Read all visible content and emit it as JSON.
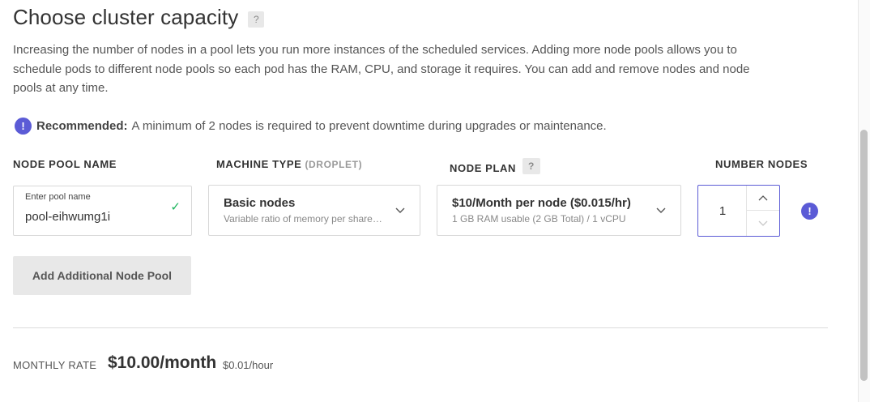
{
  "header": {
    "title": "Choose cluster capacity",
    "help_label": "?"
  },
  "description": "Increasing the number of nodes in a pool lets you run more instances of the scheduled services. Adding more node pools allows you to schedule pods to different node pools so each pod has the RAM, CPU, and storage it requires. You can add and remove nodes and node pools at any time.",
  "recommendation": {
    "icon_glyph": "!",
    "strong": "Recommended:",
    "text": "A minimum of 2 nodes is required to prevent downtime during upgrades or maintenance."
  },
  "columns": {
    "pool_name": "NODE POOL NAME",
    "machine_type": "MACHINE TYPE",
    "machine_type_suffix": "(DROPLET)",
    "node_plan": "NODE PLAN",
    "node_plan_help": "?",
    "number_nodes": "NUMBER NODES"
  },
  "pool_name_field": {
    "label": "Enter pool name",
    "value": "pool-eihwumg1i",
    "check_glyph": "✓"
  },
  "machine_type_select": {
    "main": "Basic nodes",
    "sub": "Variable ratio of memory per shared CPU"
  },
  "node_plan_select": {
    "main": "$10/Month per node ($0.015/hr)",
    "sub": "1 GB RAM usable (2 GB Total) / 1 vCPU"
  },
  "node_count": {
    "value": "1",
    "warning_glyph": "!"
  },
  "add_pool_button": "Add Additional Node Pool",
  "monthly": {
    "label": "MONTHLY RATE",
    "value": "$10.00/month",
    "hourly": "$0.01/hour"
  },
  "colors": {
    "accent": "#5b5bd6",
    "success": "#1bb55c"
  }
}
